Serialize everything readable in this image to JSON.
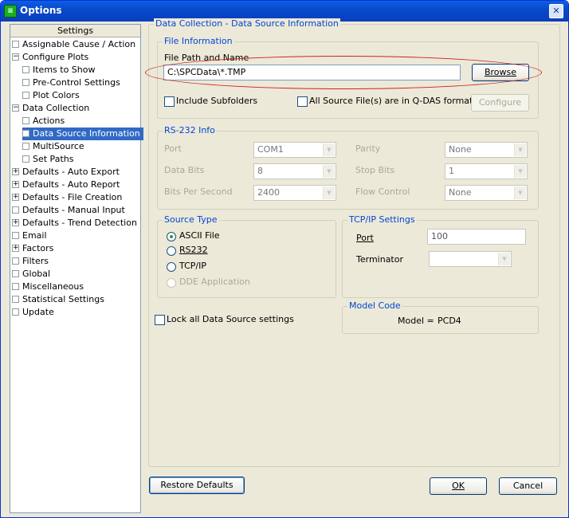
{
  "window": {
    "title": "Options",
    "icon": "app-icon",
    "close": "✕"
  },
  "tree": {
    "header": "Settings",
    "items": [
      {
        "label": "Assignable Cause / Action",
        "expander": ""
      },
      {
        "label": "Configure Plots",
        "expander": "−"
      },
      {
        "label": "Items to Show",
        "expander": ""
      },
      {
        "label": "Pre-Control Settings",
        "expander": ""
      },
      {
        "label": "Plot Colors",
        "expander": ""
      },
      {
        "label": "Data Collection",
        "expander": "−"
      },
      {
        "label": "Actions",
        "expander": ""
      },
      {
        "label": "Data Source Information",
        "expander": "",
        "selected": true
      },
      {
        "label": "MultiSource",
        "expander": ""
      },
      {
        "label": "Set Paths",
        "expander": ""
      },
      {
        "label": "Defaults - Auto Export",
        "expander": "+"
      },
      {
        "label": "Defaults - Auto Report",
        "expander": "+"
      },
      {
        "label": "Defaults - File Creation",
        "expander": "+"
      },
      {
        "label": "Defaults - Manual Input",
        "expander": ""
      },
      {
        "label": "Defaults - Trend Detection",
        "expander": "+"
      },
      {
        "label": "Email",
        "expander": ""
      },
      {
        "label": "Factors",
        "expander": "+"
      },
      {
        "label": "Filters",
        "expander": ""
      },
      {
        "label": "Global",
        "expander": ""
      },
      {
        "label": "Miscellaneous",
        "expander": ""
      },
      {
        "label": "Statistical Settings",
        "expander": ""
      },
      {
        "label": "Update",
        "expander": ""
      }
    ]
  },
  "main": {
    "panel_title": "Data Collection - Data Source Information",
    "file_info": {
      "title": "File Information",
      "path_label": "File Path and Name",
      "path_value": "C:\\SPCData\\*.TMP",
      "browse": "Browse",
      "include_subfolders": "Include Subfolders",
      "qdas": "All Source File(s) are in Q-DAS format",
      "configure": "Configure"
    },
    "rs232": {
      "title": "RS-232 Info",
      "port_label": "Port",
      "port_value": "COM1",
      "databits_label": "Data Bits",
      "databits_value": "8",
      "bps_label": "Bits Per Second",
      "bps_value": "2400",
      "parity_label": "Parity",
      "parity_value": "None",
      "stopbits_label": "Stop Bits",
      "stopbits_value": "1",
      "flow_label": "Flow Control",
      "flow_value": "None"
    },
    "source_type": {
      "title": "Source Type",
      "options": [
        "ASCII File",
        "RS232",
        "TCP/IP",
        "DDE Application"
      ],
      "selected": "ASCII File"
    },
    "tcpip": {
      "title": "TCP/IP Settings",
      "port_label": "Port",
      "port_value": "100",
      "terminator_label": "Terminator",
      "terminator_value": ""
    },
    "lock": "Lock all Data Source settings",
    "model_code": {
      "title": "Model Code",
      "label": "Model =",
      "value": "PCD4"
    }
  },
  "footer": {
    "restore": "Restore Defaults",
    "ok": "OK",
    "cancel": "Cancel"
  },
  "colors": {
    "titlebar": "#0A5FE3",
    "selection": "#316AC5",
    "accent": "#0046D5",
    "highlight_oval": "#D02020"
  }
}
